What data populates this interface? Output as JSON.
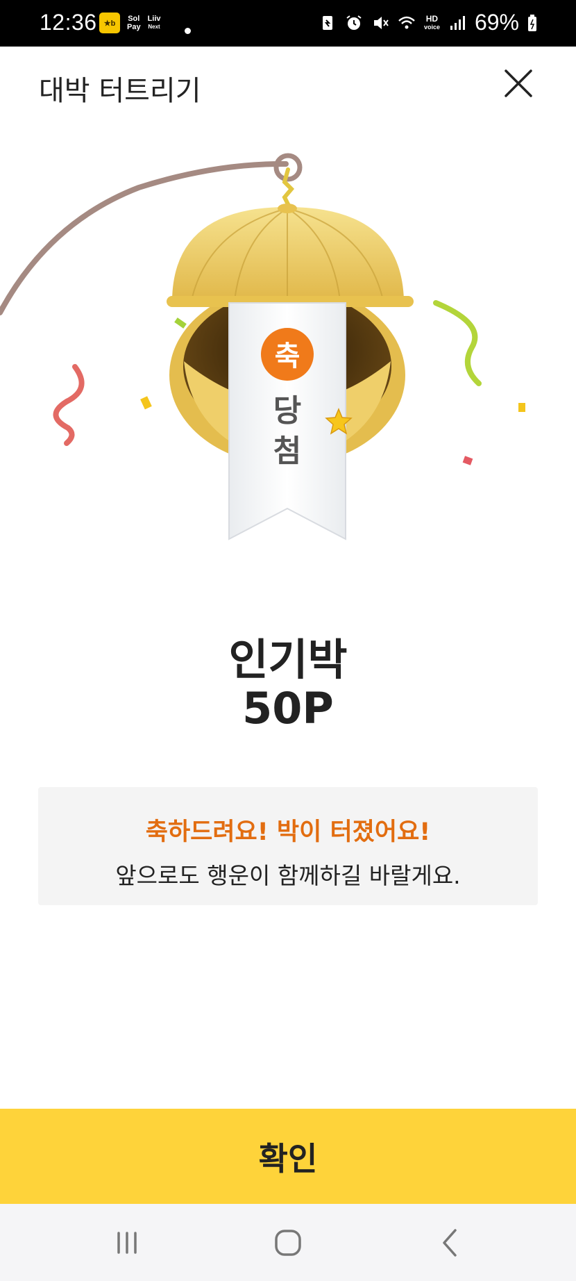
{
  "status_bar": {
    "time": "12:36",
    "app_icons": [
      "kb-app-icon",
      "sol-pay-icon",
      "liiv-next-icon"
    ],
    "sol_label": "Sol",
    "sol_sub": "Pay",
    "liiv_label": "Liiv",
    "liiv_sub": "Next",
    "hd_label": "HD",
    "hd_sub": "voice",
    "battery": "69%"
  },
  "header": {
    "title": "대박 터트리기",
    "close_icon": "close-icon"
  },
  "illustration": {
    "ribbon_badge": "축",
    "ribbon_text_1": "당",
    "ribbon_text_2": "첨",
    "colors": {
      "gold": "#e9c65a",
      "badge": "#f07a1a",
      "rope": "#a58a82"
    }
  },
  "reward": {
    "name": "인기박",
    "points": "50P"
  },
  "message": {
    "headline": "축하드려요! 박이 터졌어요!",
    "sub": "앞으로도 행운이 함께하길 바랄게요."
  },
  "confirm_button": {
    "label": "확인",
    "color": "#fed33a"
  },
  "nav_bar": {
    "items": [
      "recent-apps-icon",
      "home-icon",
      "back-icon"
    ]
  }
}
